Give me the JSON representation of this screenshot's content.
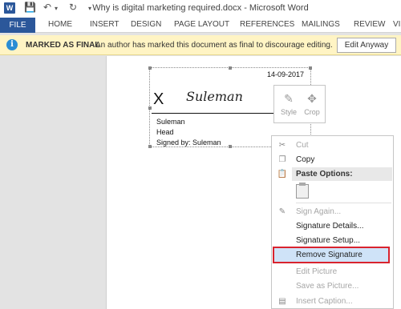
{
  "titlebar": {
    "app_icon_letter": "W",
    "title": "Why is digital marketing required.docx - Microsoft Word"
  },
  "ribbon": {
    "file_tab": "FILE",
    "tabs": [
      "HOME",
      "INSERT",
      "DESIGN",
      "PAGE LAYOUT",
      "REFERENCES",
      "MAILINGS",
      "REVIEW",
      "VIEW"
    ]
  },
  "final_bar": {
    "label": "MARKED AS FINAL",
    "message": "An author has marked this document as final to discourage editing.",
    "edit_button": "Edit Anyway"
  },
  "signature": {
    "date": "14-09-2017",
    "x_mark": "X",
    "script_name": "Suleman",
    "name": "Suleman",
    "role": "Head",
    "signed_by": "Signed by: Suleman"
  },
  "mini_toolbar": {
    "style_label": "Style",
    "crop_label": "Crop"
  },
  "context_menu": {
    "cut": "Cut",
    "copy": "Copy",
    "paste_options": "Paste Options:",
    "sign_again": "Sign Again...",
    "signature_details": "Signature Details...",
    "signature_setup": "Signature Setup...",
    "remove_signature": "Remove Signature",
    "edit_picture": "Edit Picture",
    "save_as_picture": "Save as Picture...",
    "insert_caption": "Insert Caption..."
  },
  "colors": {
    "accent": "#2b579a",
    "final_bar_bg": "#fff4c4",
    "highlight_outline": "#d9232e"
  }
}
